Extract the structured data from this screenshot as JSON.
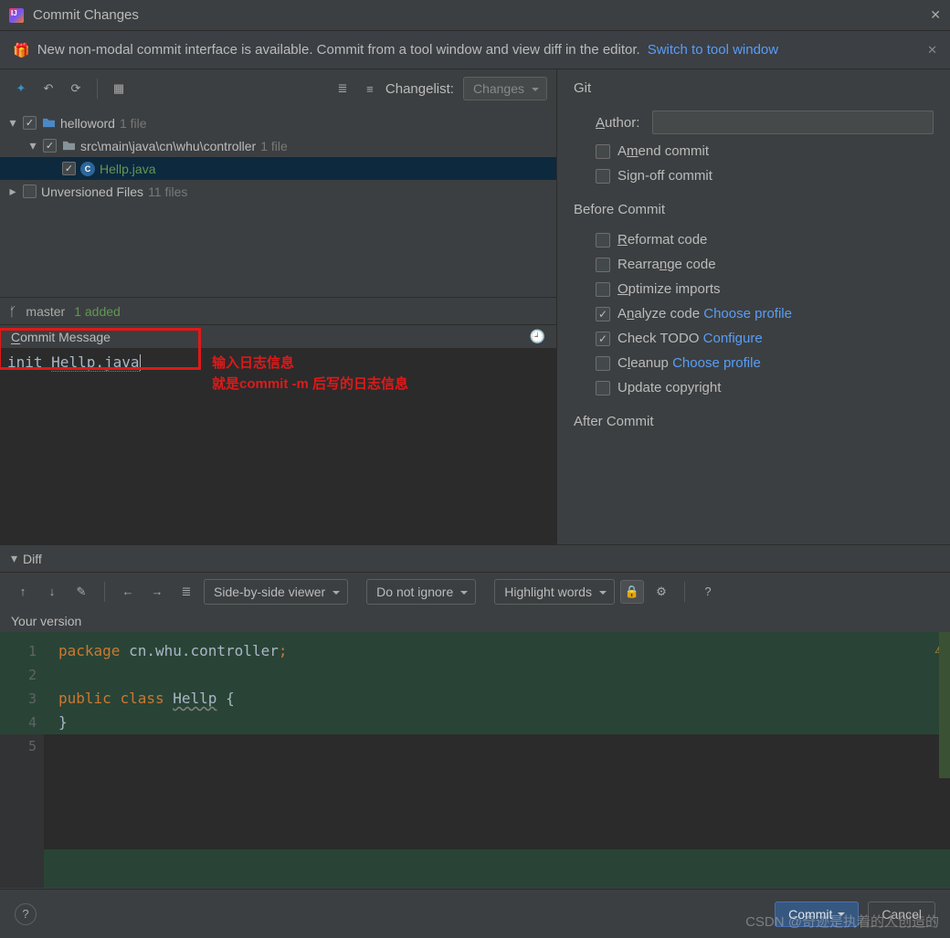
{
  "window": {
    "title": "Commit Changes"
  },
  "banner": {
    "text": "New non-modal commit interface is available. Commit from a tool window and view diff in the editor.",
    "link": "Switch to tool window"
  },
  "toolbar": {
    "changelist_label": "Changelist:",
    "changelist_value": "Changes"
  },
  "tree": {
    "root": {
      "name": "helloword",
      "meta": "1 file"
    },
    "path": {
      "name": "src\\main\\java\\cn\\whu\\controller",
      "meta": "1 file"
    },
    "file": {
      "name": "Hellp.java"
    },
    "unversioned": {
      "name": "Unversioned Files",
      "meta": "11 files"
    }
  },
  "status": {
    "branch": "master",
    "added": "1 added"
  },
  "commit_message": {
    "label": "Commit Message",
    "label_u": "C",
    "value": "init Hellp.java"
  },
  "annotations": {
    "line1": "输入日志信息",
    "line2": "就是commit -m 后写的日志信息"
  },
  "git": {
    "title": "Git",
    "author_label": "Author:",
    "author_u": "A",
    "amend": "Amend commit",
    "amend_u": "m",
    "signoff": "Sign-off commit",
    "before_title": "Before Commit",
    "reformat": "Reformat code",
    "reformat_u": "R",
    "rearrange": "Rearrange code",
    "rearrange_u": "n",
    "optimize": "Optimize imports",
    "optimize_u": "O",
    "analyze": "Analyze code ",
    "analyze_u": "n",
    "analyze_link": "Choose profile",
    "todo": "Check TODO ",
    "todo_link": "Configure",
    "cleanup": "Cleanup ",
    "cleanup_u": "l",
    "cleanup_link": "Choose profile",
    "copyright": "Update copyright",
    "after_title": "After Commit"
  },
  "diff": {
    "label": "Diff",
    "viewer": "Side-by-side viewer",
    "ignore": "Do not ignore",
    "highlight": "Highlight words",
    "version": "Your version"
  },
  "code": {
    "l1a": "package",
    "l1b": "cn.whu.controller",
    "l3a": "public",
    "l3b": "class",
    "l3c": "Hellp",
    "l3d": "{",
    "l4": "}"
  },
  "footer": {
    "commit": "Commit",
    "cancel": "Cancel"
  },
  "watermark": "CSDN @奇迹是执着的人创造的"
}
